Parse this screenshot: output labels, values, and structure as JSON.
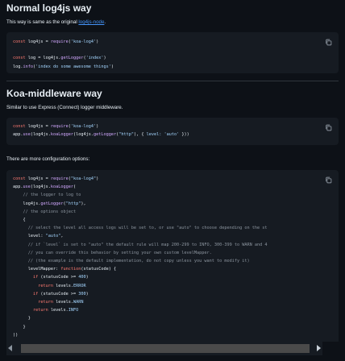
{
  "sections": {
    "normal": {
      "heading": "Normal log4js way",
      "desc_prefix": "This way is same as the original ",
      "desc_link": "log4js-node",
      "desc_suffix": "."
    },
    "koa": {
      "heading": "Koa-middleware way",
      "desc": "Similar to use Express (Connect) logger middleware."
    },
    "more": {
      "desc": "There are more configuration options:"
    }
  },
  "code": {
    "b1": {
      "l1": [
        "const",
        " log4js = ",
        "require",
        "(",
        "'koa-log4'",
        ")"
      ],
      "l2": [
        "const",
        " log = log4js.",
        "getLogger",
        "(",
        "'index'",
        ")"
      ],
      "l3": [
        "log.",
        "info",
        "(",
        "'index do some awesome things'",
        ")"
      ]
    },
    "b2": {
      "l1": [
        "const",
        " log4js = ",
        "require",
        "(",
        "'koa-log4'",
        ")"
      ],
      "l2": [
        "app.",
        "use",
        "(log4js.",
        "koaLogger",
        "(log4js.",
        "getLogger",
        "(",
        "\"http\"",
        "), { ",
        "level:",
        " ",
        "'auto'",
        " }))"
      ]
    },
    "b3": {
      "l1": [
        "const",
        " log4js = ",
        "require",
        "(",
        "\"koa-log4\"",
        ")"
      ],
      "l2": [
        "app.",
        "use",
        "(log4js.",
        "koaLogger",
        "("
      ],
      "l3": "    // the logger to log to",
      "l4": [
        "    log4js.",
        "getLogger",
        "(",
        "\"http\"",
        "),"
      ],
      "l5": "    // the options object",
      "l6": "    {",
      "l7": "      // select the level all access logs will be set to, or use \"auto\" to choose depending on the st",
      "l8": [
        "      level: ",
        "\"auto\"",
        ","
      ],
      "l9": "      // if `level` is set to \"auto\" the default rule will map 200-299 to INFO, 300-399 to WARN and 4",
      "l10": "      // you can override this behavior by setting your own custom levelMapper.",
      "l11": "      // (the example is the default implementation, do not copy unless you want to modify it)",
      "l12": [
        "      levelMapper: ",
        "function",
        "(statusCode) {"
      ],
      "l13": [
        "        ",
        "if",
        " (statusCode >= ",
        "400",
        ")"
      ],
      "l14": [
        "          ",
        "return",
        " levels.",
        "ERROR"
      ],
      "l15": [
        "        ",
        "if",
        " (statusCode >= ",
        "300",
        ")"
      ],
      "l16": [
        "          ",
        "return",
        " levels.",
        "WARN"
      ],
      "l17": [
        "        ",
        "return",
        " levels.",
        "INFO"
      ],
      "l18": "      }",
      "l19": "    }",
      "l20": "))"
    }
  },
  "icons": {
    "copy": "copy-icon",
    "scroll_left": "chevron-left-icon",
    "scroll_right": "chevron-right-icon"
  },
  "colors": {
    "bg": "#0d1117",
    "code_bg": "#161b22",
    "keyword": "#ff7b72",
    "function": "#d2a8ff",
    "string": "#a5d6ff",
    "comment": "#8b949e",
    "link": "#4493f8"
  }
}
